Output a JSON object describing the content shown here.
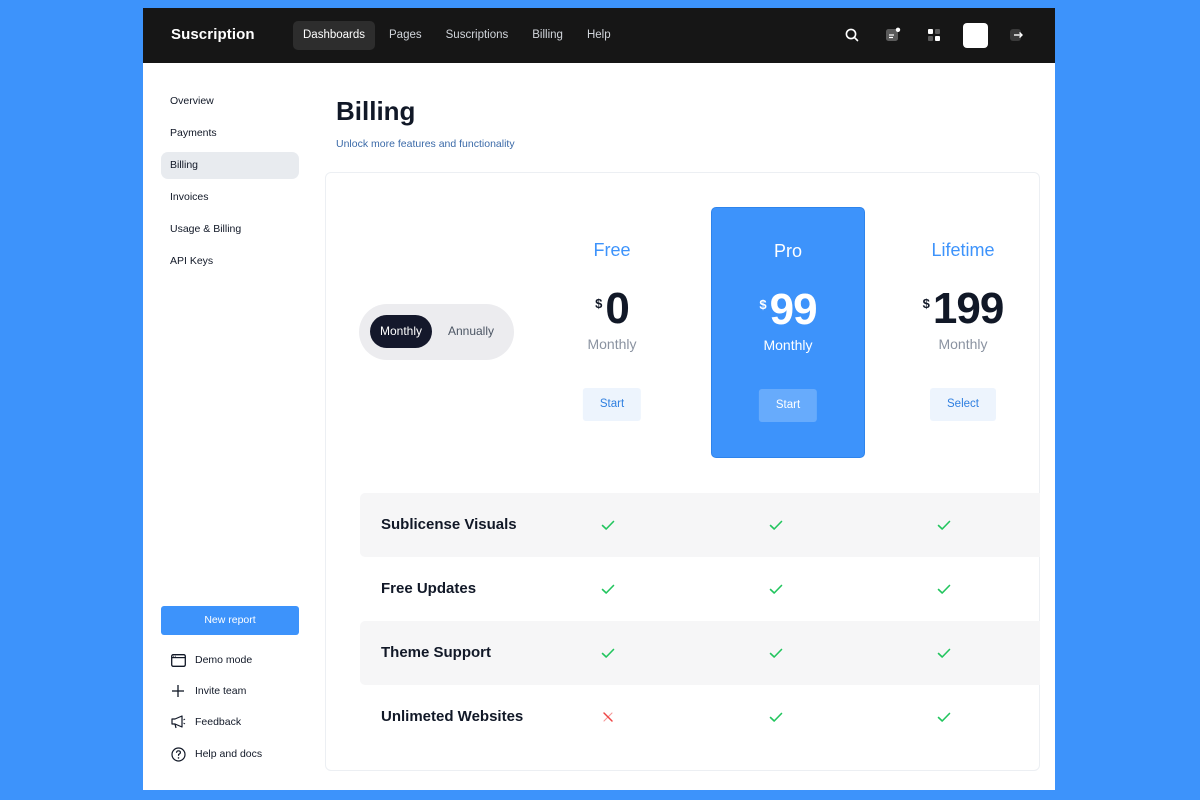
{
  "topbar": {
    "brand": "Suscription",
    "nav": [
      "Dashboards",
      "Pages",
      "Suscriptions",
      "Billing",
      "Help"
    ],
    "active_nav": "Dashboards",
    "icons": [
      "search-icon",
      "notes-icon",
      "apps-icon",
      "avatar",
      "logout-icon"
    ]
  },
  "sidebar": {
    "items": [
      "Overview",
      "Payments",
      "Billing",
      "Invoices",
      "Usage & Billing",
      "API Keys"
    ],
    "active": "Billing",
    "new_report": "New report",
    "utilities": [
      {
        "label": "Demo mode",
        "icon": "window-icon"
      },
      {
        "label": "Invite team",
        "icon": "plus-icon"
      },
      {
        "label": "Feedback",
        "icon": "megaphone-icon"
      },
      {
        "label": "Help and docs",
        "icon": "question-circle-icon"
      }
    ]
  },
  "main": {
    "title": "Billing",
    "subtitle": "Unlock more features and functionality",
    "toggle": {
      "monthly": "Monthly",
      "annually": "Annually",
      "selected": "Monthly"
    },
    "plans": [
      {
        "name": "Free",
        "currency": "$",
        "price": "0",
        "period": "Monthly",
        "button": "Start",
        "highlighted": false
      },
      {
        "name": "Pro",
        "currency": "$",
        "price": "99",
        "period": "Monthly",
        "button": "Start",
        "highlighted": true
      },
      {
        "name": "Lifetime",
        "currency": "$",
        "price": "199",
        "period": "Monthly",
        "button": "Select",
        "highlighted": false
      }
    ],
    "features": [
      {
        "label": "Sublicense Visuals",
        "free": true,
        "pro": true,
        "lifetime": true
      },
      {
        "label": "Free Updates",
        "free": true,
        "pro": true,
        "lifetime": true
      },
      {
        "label": "Theme Support",
        "free": true,
        "pro": true,
        "lifetime": true
      },
      {
        "label": "Unlimeted Websites",
        "free": false,
        "pro": true,
        "lifetime": true
      }
    ]
  },
  "colors": {
    "background": "#3d93fb",
    "accent": "#3d93fb",
    "topbar": "#161616",
    "check": "#22c55e",
    "cross": "#ef4444"
  }
}
